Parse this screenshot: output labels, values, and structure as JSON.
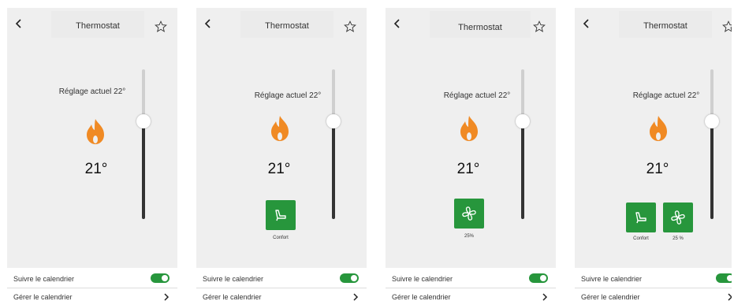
{
  "screens": [
    {
      "title": "Thermostat",
      "setting": "Réglage actuel 22°",
      "temperature": "21°",
      "slider_level": 0.35,
      "calendar_follow": "Suivre le calendrier",
      "calendar_manage": "Gérer le calendrier",
      "follow_calendar_on": true
    },
    {
      "title": "Thermostat",
      "setting": "Réglage actuel 22°",
      "temperature": "21°",
      "slider_level": 0.35,
      "mode_label": "Confort",
      "calendar_follow": "Suivre le calendrier",
      "calendar_manage": "Gérer le calendrier",
      "follow_calendar_on": true
    },
    {
      "title": "Thermostat",
      "setting": "Réglage actuel 22°",
      "temperature": "21°",
      "slider_level": 0.35,
      "fan_label": "25%",
      "calendar_follow": "Suivre le calendrier",
      "calendar_manage": "Gérer le calendrier",
      "follow_calendar_on": true
    },
    {
      "title": "Thermostat",
      "setting": "Réglage actuel 22°",
      "temperature": "21°",
      "slider_level": 0.35,
      "mode_label": "Confort",
      "fan_label": "25 %",
      "calendar_follow": "Suivre le calendrier",
      "calendar_manage": "Gérer le calendrier",
      "follow_calendar_on": true
    }
  ],
  "icons": {
    "back": "chevron-left-icon",
    "favorite": "star-outline-icon",
    "flame": "flame-icon",
    "mode": "armchair-icon",
    "fan": "fan-icon",
    "chevron": "chevron-right-icon"
  },
  "colors": {
    "accent_green": "#27963c",
    "flame_orange": "#f08a24",
    "panel_bg": "#efefef"
  }
}
